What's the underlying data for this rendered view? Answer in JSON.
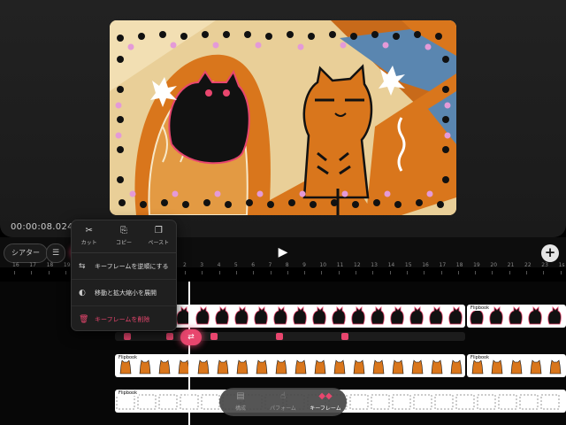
{
  "timecode": "00:00:08.024",
  "toolbar": {
    "theater_label": "シアター",
    "list_icon": "list-icon",
    "play_icon": "▶",
    "add_icon": "+"
  },
  "ruler": {
    "labels": [
      "16",
      "17",
      "18",
      "19",
      "20",
      "21",
      "22",
      "23",
      "0s",
      "1",
      "2",
      "3",
      "4",
      "5",
      "6",
      "7",
      "8",
      "9",
      "10",
      "11",
      "12",
      "13",
      "14",
      "15",
      "16",
      "17",
      "18",
      "19",
      "20",
      "21",
      "22",
      "23",
      "1s"
    ]
  },
  "context_menu": {
    "cut": "カット",
    "copy": "コピー",
    "paste": "ペースト",
    "reverse": "キーフレームを逆順にする",
    "expand": "移動と拡大縮小を展開",
    "delete": "キーフレームを削除"
  },
  "tracks": {
    "flipbook_label": "Flipbook"
  },
  "tabs": [
    {
      "label": "構成",
      "icon": "layers-icon"
    },
    {
      "label": "パフォーム",
      "icon": "hand-icon"
    },
    {
      "label": "キーフレーム",
      "icon": "keyframe-icon"
    }
  ],
  "colors": {
    "accent": "#e8466e",
    "orange": "#d9761c"
  }
}
